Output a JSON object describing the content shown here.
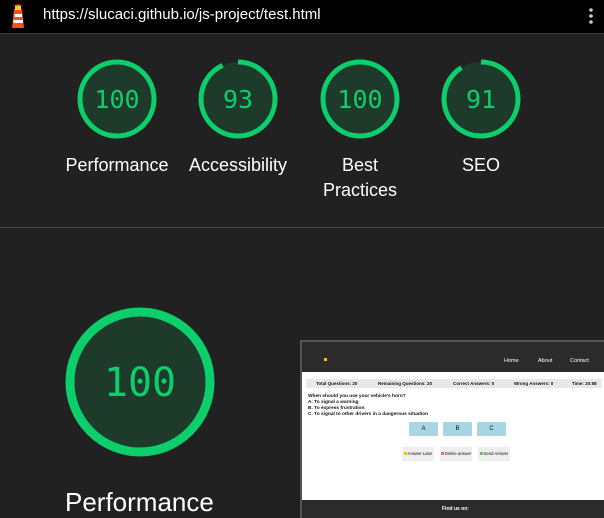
{
  "browser": {
    "url": "https://slucaci.github.io/js-project/test.html"
  },
  "colors": {
    "pass": "#0cce6b",
    "background": "#212121"
  },
  "summary_scores": [
    {
      "score": 100,
      "label": "Performance"
    },
    {
      "score": 93,
      "label": "Accessibility"
    },
    {
      "score": 100,
      "label": "Best Practices"
    },
    {
      "score": 91,
      "label": "SEO"
    }
  ],
  "performance_section": {
    "score": 100,
    "label": "Performance"
  },
  "page_screenshot": {
    "nav_links": [
      "Home",
      "About",
      "Contact"
    ],
    "stats": [
      "Total Questions: 20",
      "Remaining Questions: 20",
      "Correct Answers: 0",
      "Wrong Answers: 0",
      "Time: 20:58"
    ],
    "question": "When should you use your vehicle's horn?",
    "options": [
      "A. To signal a warning",
      "B. To express frustration",
      "C. To signal to other drivers in a dangerous situation"
    ],
    "answer_buttons": [
      "A",
      "B",
      "C"
    ],
    "action_buttons": [
      "Answer Later",
      "Delete answer",
      "Send Answer"
    ],
    "footer_text": "Find us on:"
  }
}
